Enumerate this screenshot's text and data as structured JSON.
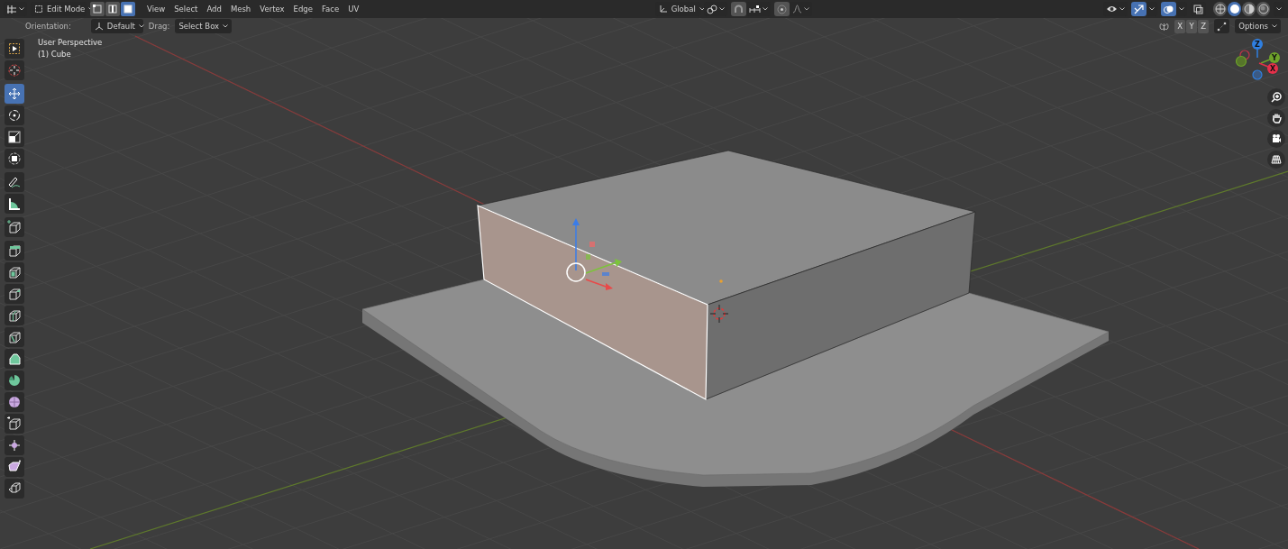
{
  "header": {
    "mode": "Edit Mode",
    "select_modes": [
      {
        "kind": "vertex",
        "selected": false
      },
      {
        "kind": "edge",
        "selected": false
      },
      {
        "kind": "face",
        "selected": true
      }
    ],
    "menus": [
      "View",
      "Select",
      "Add",
      "Mesh",
      "Vertex",
      "Edge",
      "Face",
      "UV"
    ],
    "orientation": "Global",
    "snap_on": false,
    "proportional_on": false,
    "gizmo_on": true,
    "overlays_on": true,
    "xray_on": false,
    "shading": [
      {
        "kind": "wireframe",
        "selected": false
      },
      {
        "kind": "solid",
        "selected": true
      },
      {
        "kind": "material",
        "selected": false
      },
      {
        "kind": "rendered",
        "selected": false
      }
    ]
  },
  "tool_settings": {
    "orientation_label": "Orientation:",
    "orientation_value": "Default",
    "drag_label": "Drag:",
    "drag_value": "Select Box",
    "mirror_axes": [
      {
        "label": "X",
        "on": false
      },
      {
        "label": "Y",
        "on": false
      },
      {
        "label": "Z",
        "on": false
      }
    ],
    "options": "Options"
  },
  "viewport": {
    "view_name": "User Perspective",
    "object_name": "(1) Cube",
    "face_selected": true
  },
  "toolbar": {
    "groups": [
      {
        "tools": [
          {
            "kind": "select_box",
            "selected": false
          },
          {
            "kind": "cursor",
            "selected": false
          }
        ]
      },
      {
        "tools": [
          {
            "kind": "move",
            "selected": true
          },
          {
            "kind": "rotate",
            "selected": false
          },
          {
            "kind": "scale",
            "selected": false
          },
          {
            "kind": "transform",
            "selected": false
          }
        ]
      },
      {
        "tools": [
          {
            "kind": "annotate",
            "selected": false
          },
          {
            "kind": "measure",
            "selected": false
          }
        ]
      },
      {
        "tools": [
          {
            "kind": "add_cube",
            "selected": false
          }
        ]
      },
      {
        "tools": [
          {
            "kind": "extrude",
            "selected": false
          },
          {
            "kind": "inset",
            "selected": false
          },
          {
            "kind": "bevel",
            "selected": false
          },
          {
            "kind": "loop_cut",
            "selected": false
          },
          {
            "kind": "knife",
            "selected": false
          },
          {
            "kind": "poly_build",
            "selected": false
          },
          {
            "kind": "spin",
            "selected": false
          },
          {
            "kind": "smooth",
            "selected": false
          },
          {
            "kind": "edge_slide",
            "selected": false
          },
          {
            "kind": "shrink",
            "selected": false
          },
          {
            "kind": "shear",
            "selected": false
          },
          {
            "kind": "rip",
            "selected": false
          }
        ]
      }
    ]
  },
  "gizmo": {
    "axes": [
      {
        "label": "Z"
      },
      {
        "label": "Y"
      },
      {
        "label": "X"
      }
    ]
  }
}
